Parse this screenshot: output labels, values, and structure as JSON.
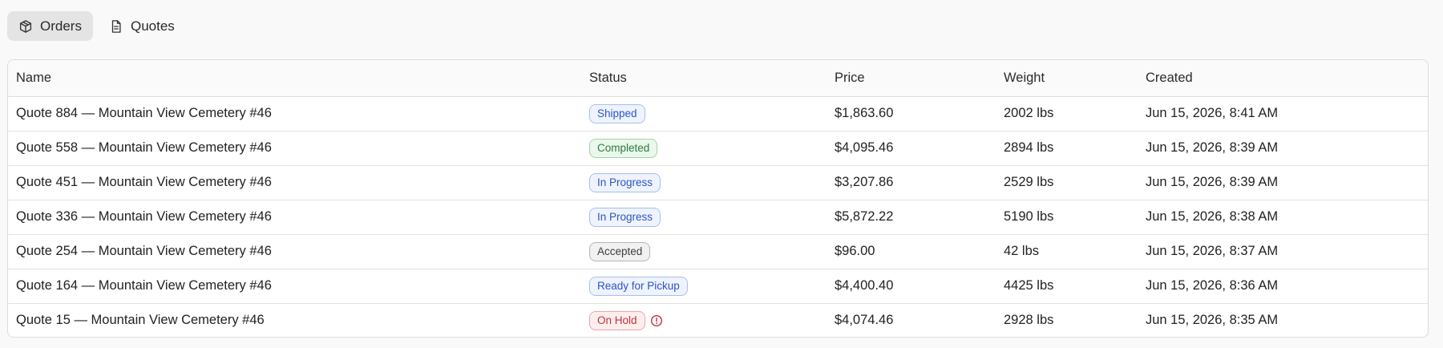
{
  "tabs": [
    {
      "label": "Orders",
      "icon": "package-icon",
      "active": true
    },
    {
      "label": "Quotes",
      "icon": "document-icon",
      "active": false
    }
  ],
  "table": {
    "headers": [
      "Name",
      "Status",
      "Price",
      "Weight",
      "Created"
    ],
    "rows": [
      {
        "name": "Quote 884 — Mountain View Cemetery #46",
        "status": "Shipped",
        "status_color": "blue",
        "price": "$1,863.60",
        "weight": "2002 lbs",
        "created": "Jun 15, 2026, 8:41 AM",
        "alert": false
      },
      {
        "name": "Quote 558 — Mountain View Cemetery #46",
        "status": "Completed",
        "status_color": "green",
        "price": "$4,095.46",
        "weight": "2894 lbs",
        "created": "Jun 15, 2026, 8:39 AM",
        "alert": false
      },
      {
        "name": "Quote 451 — Mountain View Cemetery #46",
        "status": "In Progress",
        "status_color": "blue",
        "price": "$3,207.86",
        "weight": "2529 lbs",
        "created": "Jun 15, 2026, 8:39 AM",
        "alert": false
      },
      {
        "name": "Quote 336 — Mountain View Cemetery #46",
        "status": "In Progress",
        "status_color": "blue",
        "price": "$5,872.22",
        "weight": "5190 lbs",
        "created": "Jun 15, 2026, 8:38 AM",
        "alert": false
      },
      {
        "name": "Quote 254 — Mountain View Cemetery #46",
        "status": "Accepted",
        "status_color": "gray",
        "price": "$96.00",
        "weight": "42 lbs",
        "created": "Jun 15, 2026, 8:37 AM",
        "alert": false
      },
      {
        "name": "Quote 164 — Mountain View Cemetery #46",
        "status": "Ready for Pickup",
        "status_color": "blue",
        "price": "$4,400.40",
        "weight": "4425 lbs",
        "created": "Jun 15, 2026, 8:36 AM",
        "alert": false
      },
      {
        "name": "Quote 15 — Mountain View Cemetery #46",
        "status": "On Hold",
        "status_color": "red",
        "price": "$4,074.46",
        "weight": "2928 lbs",
        "created": "Jun 15, 2026, 8:35 AM",
        "alert": true
      }
    ]
  },
  "colors": {
    "badge_blue": "#2f55c4",
    "badge_green": "#2e7d3a",
    "badge_gray": "#3d3d3d",
    "badge_red": "#c0323a",
    "active_tab_bg": "#e4e4e4"
  }
}
